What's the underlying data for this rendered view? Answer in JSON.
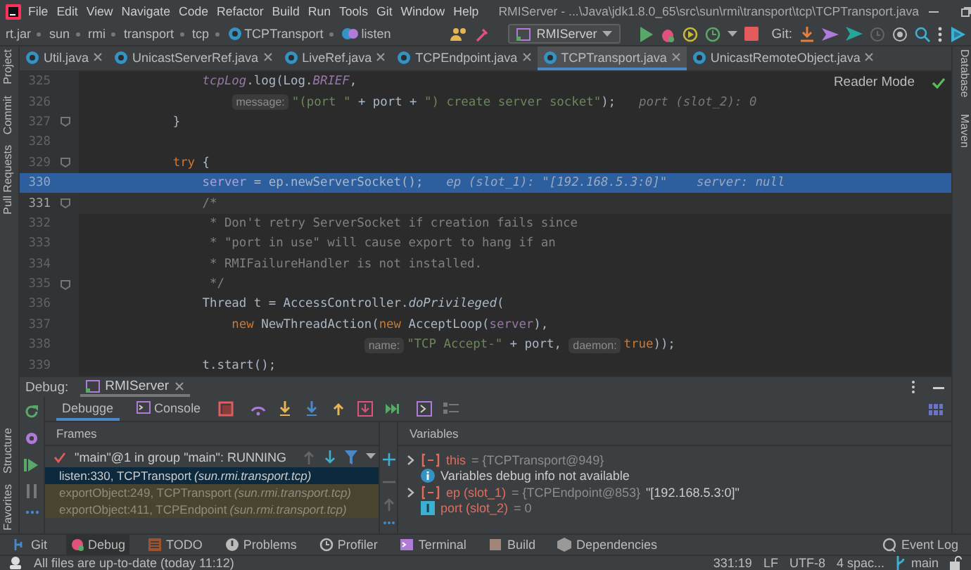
{
  "menu_bar": {
    "items": [
      "File",
      "Edit",
      "View",
      "Navigate",
      "Code",
      "Refactor",
      "Build",
      "Run",
      "Tools",
      "Git",
      "Window",
      "Help"
    ],
    "title": "RMIServer - ...\\Java\\jdk1.8.0_65\\src\\sun\\rmi\\transport\\tcp\\TCPTransport.java"
  },
  "breadcrumb": [
    {
      "label": "rt.jar",
      "kind": "jar"
    },
    {
      "label": "sun",
      "kind": "package"
    },
    {
      "label": "rmi",
      "kind": "package"
    },
    {
      "label": "transport",
      "kind": "package"
    },
    {
      "label": "tcp",
      "kind": "package"
    },
    {
      "label": "TCPTransport",
      "kind": "class"
    },
    {
      "label": "listen",
      "kind": "method"
    }
  ],
  "toolbar": {
    "run_config": "RMIServer",
    "git_label": "Git:"
  },
  "tabs": [
    {
      "label": "Util.java",
      "selected": false
    },
    {
      "label": "UnicastServerRef.java",
      "selected": false
    },
    {
      "label": "LiveRef.java",
      "selected": false
    },
    {
      "label": "TCPEndpoint.java",
      "selected": false
    },
    {
      "label": "TCPTransport.java",
      "selected": true
    },
    {
      "label": "UnicastRemoteObject.java",
      "selected": false
    }
  ],
  "left_tools_top": [
    "Project",
    "Commit",
    "Pull Requests"
  ],
  "left_tools_bottom": [
    "Structure",
    "Favorites"
  ],
  "right_tools": [
    "Database",
    "Maven"
  ],
  "editor": {
    "reader_mode": "Reader Mode",
    "lines": [
      {
        "number": "325",
        "fold": false,
        "execution": false,
        "current": false,
        "tokens": [
          {
            "kind": "static",
            "text": "            tcpLog"
          },
          {
            "kind": "plain",
            "text": ".log(Log."
          },
          {
            "kind": "static",
            "text": "BRIEF"
          },
          {
            "kind": "plain",
            "text": ","
          }
        ]
      },
      {
        "number": "326",
        "fold": false,
        "execution": false,
        "current": false,
        "tokens": [
          {
            "kind": "hint",
            "text": "                message:"
          },
          {
            "kind": "string",
            "text": "\"(port \""
          },
          {
            "kind": "plain",
            "text": " + port + "
          },
          {
            "kind": "string",
            "text": "\") create server socket\""
          },
          {
            "kind": "plain",
            "text": ");"
          },
          {
            "kind": "value",
            "text": "  port (slot_2): 0"
          }
        ]
      },
      {
        "number": "327",
        "fold": true,
        "execution": false,
        "current": false,
        "tokens": [
          {
            "kind": "plain",
            "text": "        }"
          }
        ]
      },
      {
        "number": "328",
        "fold": false,
        "execution": false,
        "current": false
      },
      {
        "number": "329",
        "fold": true,
        "execution": false,
        "current": false,
        "tokens": [
          {
            "kind": "keyword",
            "text": "        try"
          },
          {
            "kind": "plain",
            "text": " {"
          }
        ]
      },
      {
        "number": "330",
        "fold": false,
        "execution": true,
        "current": false,
        "tokens": [
          {
            "kind": "field",
            "text": "            server"
          },
          {
            "kind": "plain",
            "text": " = ep.newServerSocket();"
          },
          {
            "kind": "value",
            "text": "  ep (slot_1): \"[192.168.5.3:0]\"    server: null"
          }
        ]
      },
      {
        "number": "331",
        "fold": true,
        "execution": false,
        "current": true,
        "tokens": [
          {
            "kind": "comment",
            "text": "            /*"
          }
        ]
      },
      {
        "number": "332",
        "fold": false,
        "execution": false,
        "current": false,
        "tokens": [
          {
            "kind": "comment",
            "text": "             * Don't retry ServerSocket if creation fails since"
          }
        ]
      },
      {
        "number": "333",
        "fold": false,
        "execution": false,
        "current": false,
        "tokens": [
          {
            "kind": "comment",
            "text": "             * \"port in use\" will cause export to hang if an"
          }
        ]
      },
      {
        "number": "334",
        "fold": false,
        "execution": false,
        "current": false,
        "tokens": [
          {
            "kind": "comment",
            "text": "             * RMIFailureHandler is not installed."
          }
        ]
      },
      {
        "number": "335",
        "fold": true,
        "execution": false,
        "current": false,
        "tokens": [
          {
            "kind": "comment",
            "text": "             */"
          }
        ]
      },
      {
        "number": "336",
        "fold": false,
        "execution": false,
        "current": false,
        "tokens": [
          {
            "kind": "plain",
            "text": "            Thread t = AccessController."
          },
          {
            "kind": "method",
            "text": "doPrivileged"
          },
          {
            "kind": "plain",
            "text": "("
          }
        ]
      },
      {
        "number": "337",
        "fold": false,
        "execution": false,
        "current": false,
        "tokens": [
          {
            "kind": "keyword",
            "text": "                new"
          },
          {
            "kind": "plain",
            "text": " NewThreadAction("
          },
          {
            "kind": "keyword",
            "text": "new"
          },
          {
            "kind": "plain",
            "text": " AcceptLoop("
          },
          {
            "kind": "field",
            "text": "server"
          },
          {
            "kind": "plain",
            "text": "),"
          }
        ]
      },
      {
        "number": "338",
        "fold": false,
        "execution": false,
        "current": false,
        "tokens": [
          {
            "kind": "hint",
            "text": "                                  name:"
          },
          {
            "kind": "string",
            "text": "\"TCP Accept-\""
          },
          {
            "kind": "plain",
            "text": " + port, "
          },
          {
            "kind": "hint",
            "text": "daemon:"
          },
          {
            "kind": "keyword",
            "text": "true"
          },
          {
            "kind": "plain",
            "text": "));"
          }
        ]
      },
      {
        "number": "339",
        "fold": false,
        "execution": false,
        "current": false,
        "tokens": [
          {
            "kind": "plain",
            "text": "            t.start();"
          }
        ]
      }
    ]
  },
  "debug": {
    "title": "Debug:",
    "session": "RMIServer",
    "tabs": [
      {
        "label": "Debugge",
        "selected": true
      },
      {
        "label": "Console",
        "selected": false
      }
    ],
    "frames_header": "Frames",
    "thread": "\"main\"@1 in group \"main\": RUNNING",
    "frames": [
      {
        "method": "listen:330, TCPTransport",
        "package": "(sun.rmi.transport.tcp)",
        "selected": true,
        "library": false
      },
      {
        "method": "exportObject:249, TCPTransport",
        "package": "(sun.rmi.transport.tcp)",
        "selected": false,
        "library": true
      },
      {
        "method": "exportObject:411, TCPEndpoint",
        "package": "(sun.rmi.transport.tcp)",
        "selected": false,
        "library": true
      }
    ],
    "variables_header": "Variables",
    "variables": [
      {
        "kind": "object",
        "name": "this",
        "value": "= {TCPTransport@949}"
      },
      {
        "kind": "info",
        "text": "Variables debug info not available"
      },
      {
        "kind": "object",
        "name": "ep (slot_1)",
        "value": "= {TCPEndpoint@853}",
        "string": "\"[192.168.5.3:0]\""
      },
      {
        "kind": "primitive",
        "name": "port (slot_2)",
        "value": "= 0"
      }
    ]
  },
  "bottom_tools": [
    {
      "label": "Git",
      "kind": "git",
      "selected": false
    },
    {
      "label": "Debug",
      "kind": "debug",
      "selected": true
    },
    {
      "label": "TODO",
      "kind": "todo",
      "selected": false
    },
    {
      "label": "Problems",
      "kind": "problems",
      "selected": false
    },
    {
      "label": "Profiler",
      "kind": "profiler",
      "selected": false
    },
    {
      "label": "Terminal",
      "kind": "terminal",
      "selected": false
    },
    {
      "label": "Build",
      "kind": "build",
      "selected": false
    },
    {
      "label": "Dependencies",
      "kind": "dependencies",
      "selected": false
    }
  ],
  "event_log": "Event Log",
  "status_bar": {
    "message": "All files are up-to-date (today 11:12)",
    "position": "331:19",
    "line_separator": "LF",
    "encoding": "UTF-8",
    "indent": "4 spac...",
    "branch": "main"
  }
}
